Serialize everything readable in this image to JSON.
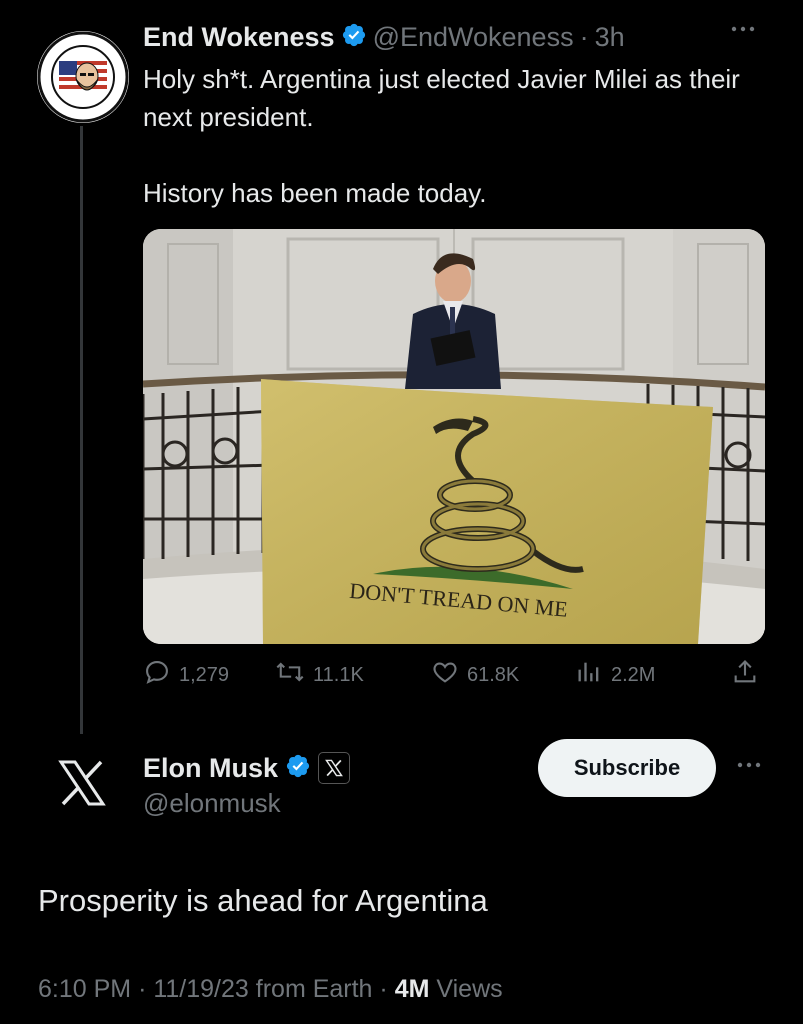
{
  "tweet1": {
    "author": {
      "name": "End Wokeness",
      "handle": "@EndWokeness",
      "separator": "·",
      "time": "3h",
      "verified": true,
      "avatar_text_top": "I SUPPORT THE",
      "avatar_text_bottom": "FORMER THINGS"
    },
    "text_line1": "Holy sh*t. Argentina just elected Javier Milei as their next president.",
    "text_line2": "History has been made today.",
    "media": {
      "flag_text": "DON'T TREAD ON ME"
    },
    "stats": {
      "replies": "1,279",
      "reposts": "11.1K",
      "likes": "61.8K",
      "views": "2.2M"
    },
    "more_icon": "more-horizontal-icon"
  },
  "tweet2": {
    "author": {
      "name": "Elon Musk",
      "handle": "@elonmusk",
      "verified": true,
      "affiliate_badge": "X"
    },
    "subscribe_label": "Subscribe",
    "text": "Prosperity is ahead for Argentina",
    "meta": {
      "time": "6:10 PM",
      "sep1": "·",
      "date": "11/19/23",
      "source": "from Earth",
      "sep2": "·",
      "views_count": "4M",
      "views_label": "Views"
    }
  },
  "colors": {
    "background": "#000000",
    "text_primary": "#e7e9ea",
    "text_secondary": "#71767b",
    "verified_blue": "#1d9bf0",
    "button_bg": "#eff3f4"
  }
}
